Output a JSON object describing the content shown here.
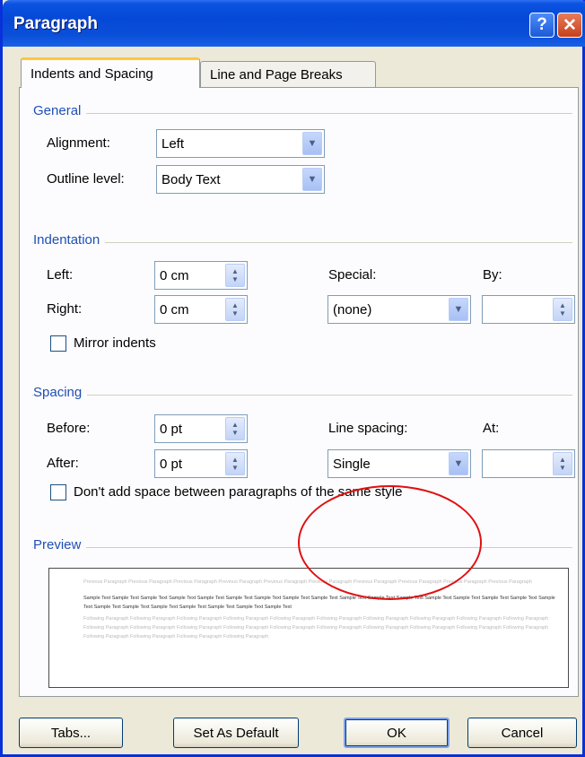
{
  "window": {
    "title": "Paragraph",
    "help_glyph": "?",
    "close_glyph": "✕"
  },
  "tabs": {
    "indents_spacing": "Indents and Spacing",
    "line_page_breaks": "Line and Page Breaks"
  },
  "general": {
    "heading": "General",
    "alignment_label": "Alignment:",
    "alignment_value": "Left",
    "outline_label": "Outline level:",
    "outline_value": "Body Text"
  },
  "indentation": {
    "heading": "Indentation",
    "left_label": "Left:",
    "left_value": "0 cm",
    "right_label": "Right:",
    "right_value": "0 cm",
    "special_label": "Special:",
    "special_value": "(none)",
    "by_label": "By:",
    "by_value": "",
    "mirror_label": "Mirror indents",
    "mirror_checked": false
  },
  "spacing": {
    "heading": "Spacing",
    "before_label": "Before:",
    "before_value": "0 pt",
    "after_label": "After:",
    "after_value": "0 pt",
    "line_spacing_label": "Line spacing:",
    "line_spacing_value": "Single",
    "at_label": "At:",
    "at_value": "",
    "dont_add_label": "Don't add space between paragraphs of the same style",
    "dont_add_checked": false
  },
  "preview": {
    "heading": "Preview",
    "previous_text": "Previous Paragraph Previous Paragraph Previous Paragraph Previous Paragraph Previous Paragraph Previous Paragraph Previous Paragraph Previous Paragraph Previous Paragraph Previous Paragraph",
    "sample_text": "Sample Text Sample Text Sample Text Sample Text Sample Text Sample Text Sample Text Sample Text Sample Text Sample Text Sample Text Sample Text Sample Text Sample Text Sample Text Sample Text Sample Text Sample Text Sample Text Sample Text Sample Text Sample Text Sample Text Sample Text",
    "following_text": "Following Paragraph Following Paragraph Following Paragraph Following Paragraph Following Paragraph Following Paragraph Following Paragraph Following Paragraph Following Paragraph Following Paragraph Following Paragraph Following Paragraph Following Paragraph Following Paragraph Following Paragraph Following Paragraph Following Paragraph Following Paragraph Following Paragraph Following Paragraph Following Paragraph Following Paragraph Following Paragraph Following Paragraph"
  },
  "buttons": {
    "tabs": "Tabs...",
    "set_default": "Set As Default",
    "ok": "OK",
    "cancel": "Cancel"
  },
  "colors": {
    "titlebar": "#0548d8",
    "group_heading": "#1f4fb4",
    "highlight_oval": "#e01010"
  }
}
